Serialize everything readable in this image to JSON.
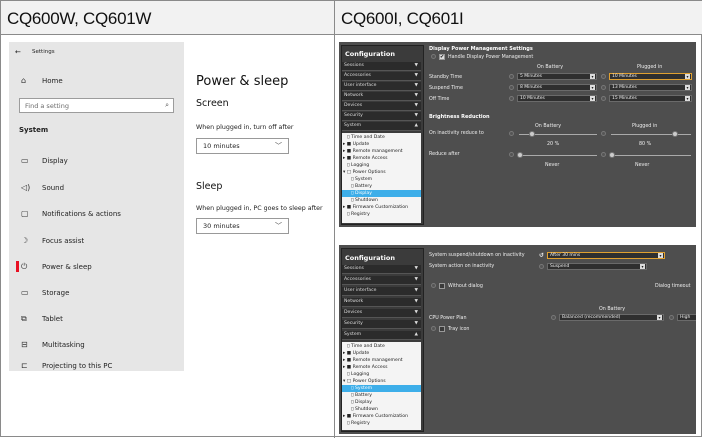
{
  "headers": {
    "left": "CQ600W, CQ601W",
    "right": "CQ600I, CQ601I"
  },
  "win": {
    "title": "Settings",
    "home": "Home",
    "find_placeholder": "Find a setting",
    "section": "System",
    "nav": [
      "Display",
      "Sound",
      "Notifications & actions",
      "Focus assist",
      "Power & sleep",
      "Storage",
      "Tablet",
      "Multitasking",
      "Projecting to this PC"
    ],
    "selected": "Power & sleep",
    "page_title": "Power & sleep",
    "screen_heading": "Screen",
    "screen_label": "When plugged in, turn off after",
    "screen_value": "10 minutes",
    "sleep_heading": "Sleep",
    "sleep_label": "When plugged in, PC goes to sleep after",
    "sleep_value": "30 minutes"
  },
  "panel1": {
    "title": "Configuration",
    "menus": [
      "Sessions",
      "Accessories",
      "User interface",
      "Network",
      "Devices",
      "Security",
      "System"
    ],
    "tree": [
      "Time and Date",
      "Update",
      "Remote management",
      "Remote Access",
      "Logging",
      "Power Options",
      "System",
      "Battery",
      "Display",
      "Shutdown",
      "Firmware Customization",
      "Registry"
    ],
    "selected": "Display",
    "dpm_title": "Display Power Management Settings",
    "dpm_check": "Handle Display Power Management",
    "col_battery": "On Battery",
    "col_plugged": "Plugged in",
    "rows": [
      {
        "label": "Standby Time",
        "battery": "5 Minutes",
        "plugged": "10 Minutes"
      },
      {
        "label": "Suspend Time",
        "battery": "8 Minutes",
        "plugged": "13 Minutes"
      },
      {
        "label": "Off Time",
        "battery": "10 Minutes",
        "plugged": "15 Minutes"
      }
    ],
    "br_title": "Brightness Reduction",
    "inactivity_label": "On inactivity reduce to",
    "battery_pct": "20 %",
    "plugged_pct": "80 %",
    "reduce_label": "Reduce after",
    "never_battery": "Never",
    "never_plugged": "Never"
  },
  "panel2": {
    "title": "Configuration",
    "menus": [
      "Sessions",
      "Accessories",
      "User interface",
      "Network",
      "Devices",
      "Security",
      "System"
    ],
    "tree": [
      "Time and Date",
      "Update",
      "Remote management",
      "Remote Access",
      "Logging",
      "Power Options",
      "System",
      "Battery",
      "Display",
      "Shutdown",
      "Firmware Customization",
      "Registry"
    ],
    "selected": "System",
    "susp_label": "System suspend/shutdown on inactivity",
    "susp_value": "After 30 mins",
    "action_label": "System action on inactivity",
    "action_value": "Suspend",
    "without_dialog": "Without dialog",
    "dialog_timeout": "Dialog timeout",
    "col_battery": "On Battery",
    "cpu_label": "CPU Power Plan",
    "cpu_value": "Balanced (recommended)",
    "cpu_high": "High",
    "tray_icon": "Tray icon"
  },
  "colors": {
    "accent_red": "#e81123",
    "linux_select": "#3daee9",
    "highlight_border": "#e0a030"
  }
}
